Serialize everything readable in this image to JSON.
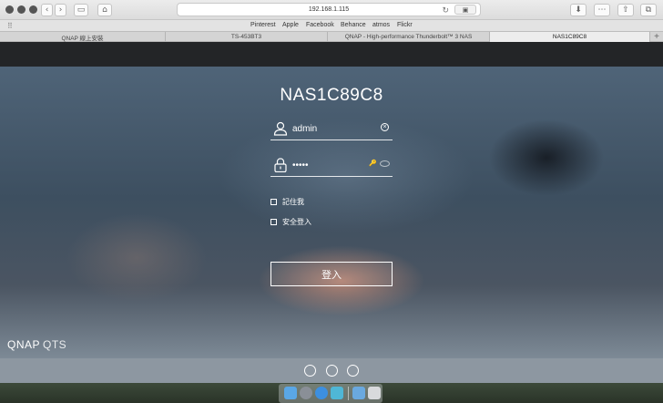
{
  "browser": {
    "url": "192.168.1.115",
    "bookmarks": [
      "Pinterest",
      "Apple",
      "Facebook",
      "Behance",
      "atmos",
      "Flickr"
    ],
    "tabs": [
      {
        "label": "QNAP 線上安裝"
      },
      {
        "label": "TS-453BT3"
      },
      {
        "label": "QNAP - High-performance Thunderbolt™ 3 NAS"
      },
      {
        "label": "NAS1C89C8"
      }
    ]
  },
  "login": {
    "device_name": "NAS1C89C8",
    "username": "admin",
    "password_mask": "•••••",
    "remember_me": "記住我",
    "secure_login": "安全登入",
    "login_button": "登入"
  },
  "brand": {
    "qnap": "QNAP",
    "qts": "QTS"
  },
  "icons": {
    "user": "user-icon",
    "lock": "lock-icon",
    "clear": "clear-icon",
    "eye": "eye-icon",
    "footer": [
      "qfinder-icon",
      "search-icon",
      "app-store-icon"
    ]
  },
  "colors": {
    "accent": "#ffffff",
    "page_top": "#232527"
  }
}
